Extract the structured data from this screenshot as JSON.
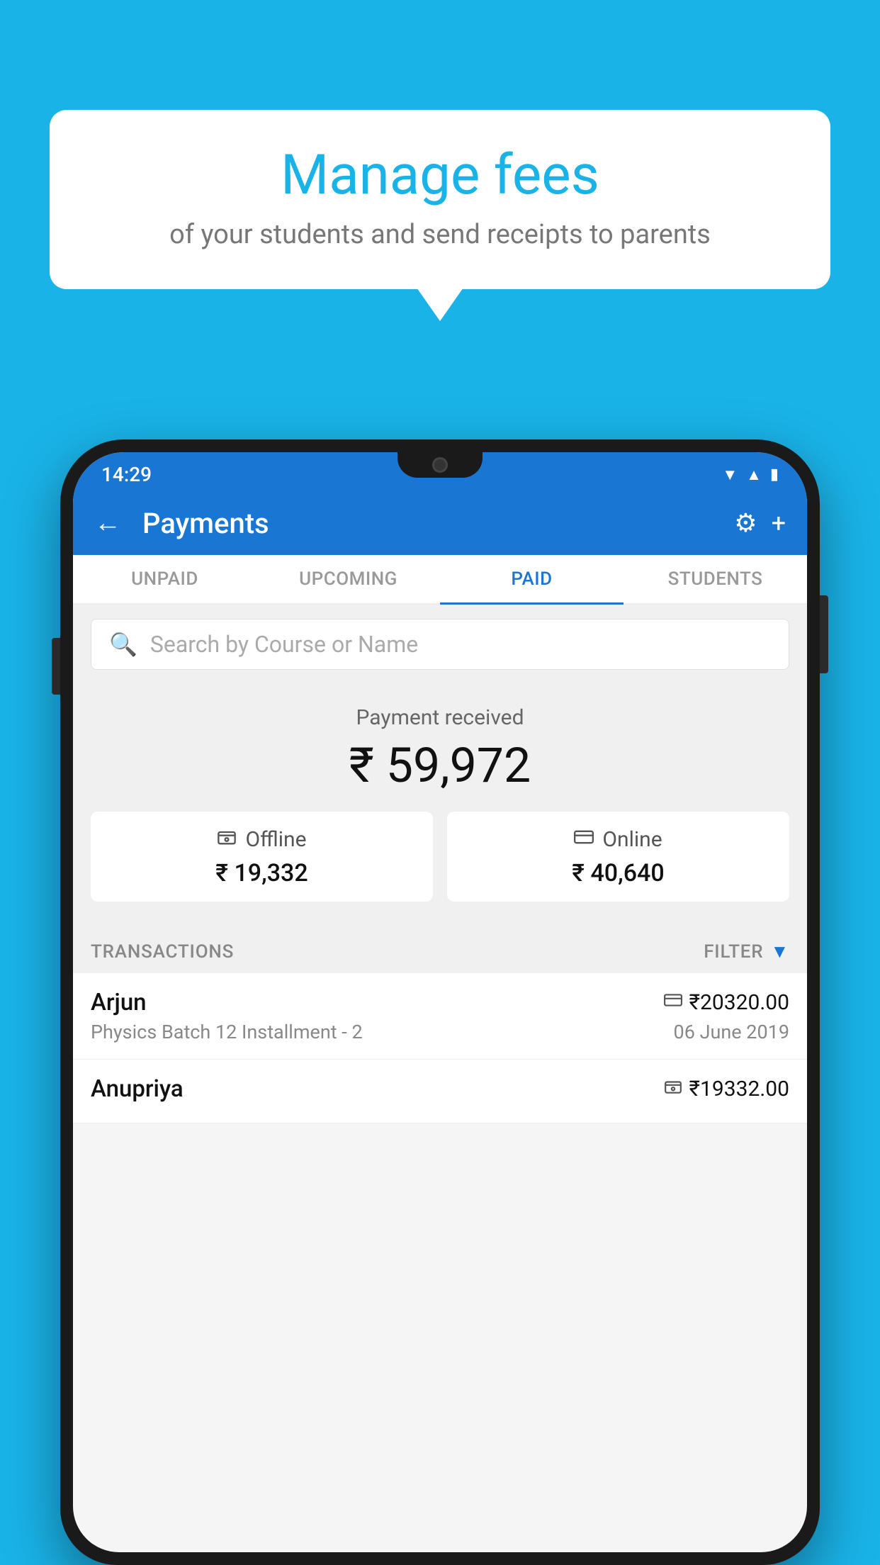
{
  "background_color": "#1ab3e8",
  "speech_bubble": {
    "title": "Manage fees",
    "subtitle": "of your students and send receipts to parents"
  },
  "status_bar": {
    "time": "14:29",
    "icons": [
      "wifi",
      "signal",
      "battery"
    ]
  },
  "header": {
    "title": "Payments",
    "back_label": "←",
    "gear_label": "⚙",
    "plus_label": "+"
  },
  "tabs": [
    {
      "label": "UNPAID",
      "active": false
    },
    {
      "label": "UPCOMING",
      "active": false
    },
    {
      "label": "PAID",
      "active": true
    },
    {
      "label": "STUDENTS",
      "active": false
    }
  ],
  "search": {
    "placeholder": "Search by Course or Name"
  },
  "payment_section": {
    "label": "Payment received",
    "total": "₹ 59,972",
    "offline": {
      "icon": "💳",
      "label": "Offline",
      "amount": "₹ 19,332"
    },
    "online": {
      "icon": "💳",
      "label": "Online",
      "amount": "₹ 40,640"
    }
  },
  "transactions": {
    "label": "TRANSACTIONS",
    "filter_label": "FILTER",
    "items": [
      {
        "name": "Arjun",
        "type_icon": "💳",
        "amount": "₹20320.00",
        "course": "Physics Batch 12 Installment - 2",
        "date": "06 June 2019"
      },
      {
        "name": "Anupriya",
        "type_icon": "💳",
        "amount": "₹19332.00",
        "course": "",
        "date": ""
      }
    ]
  }
}
